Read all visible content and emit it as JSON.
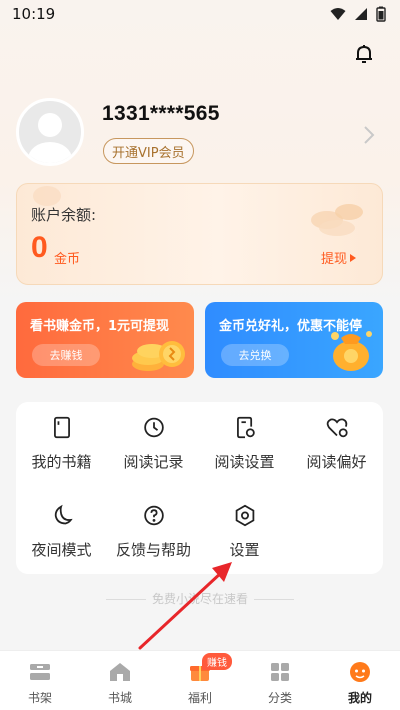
{
  "status_bar": {
    "time": "10:19"
  },
  "profile": {
    "username": "1331****565",
    "vip_button": "开通VIP会员"
  },
  "balance": {
    "label": "账户余额:",
    "amount": "0",
    "unit": "金币",
    "withdraw": "提现"
  },
  "promos": [
    {
      "title": "看书赚金币，1元可提现",
      "button": "去赚钱",
      "color": "#ff6a3d"
    },
    {
      "title": "金币兑好礼，优惠不能停",
      "button": "去兑换",
      "color": "#2f8cff"
    }
  ],
  "menu": [
    {
      "label": "我的书籍",
      "icon": "book-icon"
    },
    {
      "label": "阅读记录",
      "icon": "clock-icon"
    },
    {
      "label": "阅读设置",
      "icon": "reading-settings-icon"
    },
    {
      "label": "阅读偏好",
      "icon": "heart-icon"
    },
    {
      "label": "夜间模式",
      "icon": "moon-icon"
    },
    {
      "label": "反馈与帮助",
      "icon": "question-icon"
    },
    {
      "label": "设置",
      "icon": "hexagon-settings-icon"
    }
  ],
  "footer_note": "免费小说尽在速看",
  "tabs": [
    {
      "label": "书架",
      "icon": "bookshelf-icon"
    },
    {
      "label": "书城",
      "icon": "home-icon"
    },
    {
      "label": "福利",
      "icon": "gift-icon",
      "badge": "赚钱"
    },
    {
      "label": "分类",
      "icon": "grid-icon"
    },
    {
      "label": "我的",
      "icon": "profile-icon",
      "active": true
    }
  ],
  "colors": {
    "accent": "#ff5a1f",
    "vip": "#a8722f"
  }
}
